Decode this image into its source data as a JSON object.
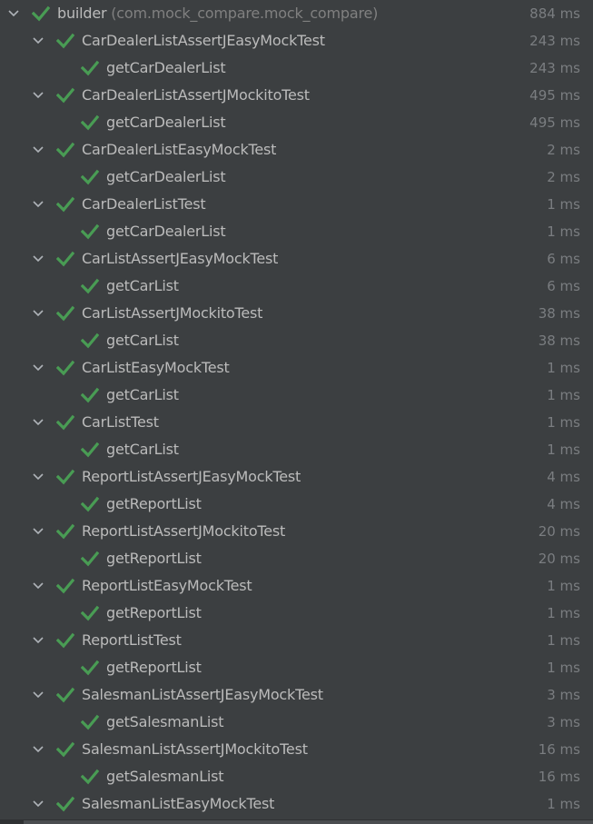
{
  "colors": {
    "background": "#3c3f41",
    "text": "#bbbbbb",
    "package_text": "#808080",
    "time_text": "#7a7d80",
    "pass_check": "#499c54"
  },
  "icons": {
    "expand": "chevron-down-icon",
    "status": "check-icon"
  },
  "root": {
    "name": "builder",
    "package": "(com.mock_compare.mock_compare)",
    "time": "884 ms",
    "status": "passed",
    "expanded": true
  },
  "suites": [
    {
      "name": "CarDealerListAssertJEasyMockTest",
      "time": "243 ms",
      "expanded": true,
      "tests": [
        {
          "name": "getCarDealerList",
          "time": "243 ms"
        }
      ]
    },
    {
      "name": "CarDealerListAssertJMockitoTest",
      "time": "495 ms",
      "expanded": true,
      "tests": [
        {
          "name": "getCarDealerList",
          "time": "495 ms"
        }
      ]
    },
    {
      "name": "CarDealerListEasyMockTest",
      "time": "2 ms",
      "expanded": true,
      "tests": [
        {
          "name": "getCarDealerList",
          "time": "2 ms"
        }
      ]
    },
    {
      "name": "CarDealerListTest",
      "time": "1 ms",
      "expanded": true,
      "tests": [
        {
          "name": "getCarDealerList",
          "time": "1 ms"
        }
      ]
    },
    {
      "name": "CarListAssertJEasyMockTest",
      "time": "6 ms",
      "expanded": true,
      "tests": [
        {
          "name": "getCarList",
          "time": "6 ms"
        }
      ]
    },
    {
      "name": "CarListAssertJMockitoTest",
      "time": "38 ms",
      "expanded": true,
      "tests": [
        {
          "name": "getCarList",
          "time": "38 ms"
        }
      ]
    },
    {
      "name": "CarListEasyMockTest",
      "time": "1 ms",
      "expanded": true,
      "tests": [
        {
          "name": "getCarList",
          "time": "1 ms"
        }
      ]
    },
    {
      "name": "CarListTest",
      "time": "1 ms",
      "expanded": true,
      "tests": [
        {
          "name": "getCarList",
          "time": "1 ms"
        }
      ]
    },
    {
      "name": "ReportListAssertJEasyMockTest",
      "time": "4 ms",
      "expanded": true,
      "tests": [
        {
          "name": "getReportList",
          "time": "4 ms"
        }
      ]
    },
    {
      "name": "ReportListAssertJMockitoTest",
      "time": "20 ms",
      "expanded": true,
      "tests": [
        {
          "name": "getReportList",
          "time": "20 ms"
        }
      ]
    },
    {
      "name": "ReportListEasyMockTest",
      "time": "1 ms",
      "expanded": true,
      "tests": [
        {
          "name": "getReportList",
          "time": "1 ms"
        }
      ]
    },
    {
      "name": "ReportListTest",
      "time": "1 ms",
      "expanded": true,
      "tests": [
        {
          "name": "getReportList",
          "time": "1 ms"
        }
      ]
    },
    {
      "name": "SalesmanListAssertJEasyMockTest",
      "time": "3 ms",
      "expanded": true,
      "tests": [
        {
          "name": "getSalesmanList",
          "time": "3 ms"
        }
      ]
    },
    {
      "name": "SalesmanListAssertJMockitoTest",
      "time": "16 ms",
      "expanded": true,
      "tests": [
        {
          "name": "getSalesmanList",
          "time": "16 ms"
        }
      ]
    },
    {
      "name": "SalesmanListEasyMockTest",
      "time": "1 ms",
      "expanded": true,
      "tests": []
    }
  ]
}
